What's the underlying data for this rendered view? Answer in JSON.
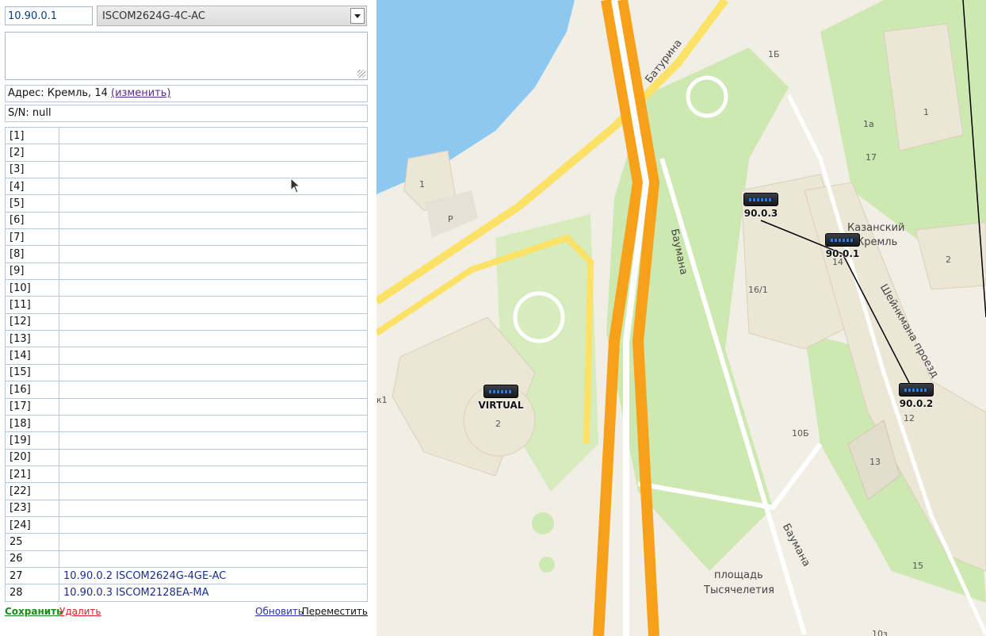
{
  "device": {
    "ip": "10.90.0.1",
    "model": "ISCOM2624G-4C-AC",
    "comment": "",
    "address_label": "Адрес: Кремль, 14",
    "address_change": "(изменить)",
    "serial": "S/N: null"
  },
  "ports": [
    {
      "num": "[1]",
      "value": ""
    },
    {
      "num": "[2]",
      "value": ""
    },
    {
      "num": "[3]",
      "value": ""
    },
    {
      "num": "[4]",
      "value": ""
    },
    {
      "num": "[5]",
      "value": ""
    },
    {
      "num": "[6]",
      "value": ""
    },
    {
      "num": "[7]",
      "value": ""
    },
    {
      "num": "[8]",
      "value": ""
    },
    {
      "num": "[9]",
      "value": ""
    },
    {
      "num": "[10]",
      "value": ""
    },
    {
      "num": "[11]",
      "value": ""
    },
    {
      "num": "[12]",
      "value": ""
    },
    {
      "num": "[13]",
      "value": ""
    },
    {
      "num": "[14]",
      "value": ""
    },
    {
      "num": "[15]",
      "value": ""
    },
    {
      "num": "[16]",
      "value": ""
    },
    {
      "num": "[17]",
      "value": ""
    },
    {
      "num": "[18]",
      "value": ""
    },
    {
      "num": "[19]",
      "value": ""
    },
    {
      "num": "[20]",
      "value": ""
    },
    {
      "num": "[21]",
      "value": ""
    },
    {
      "num": "[22]",
      "value": ""
    },
    {
      "num": "[23]",
      "value": ""
    },
    {
      "num": "[24]",
      "value": ""
    },
    {
      "num": "25",
      "value": ""
    },
    {
      "num": "26",
      "value": ""
    },
    {
      "num": "27",
      "value": "10.90.0.2 ISCOM2624G-4GE-AC"
    },
    {
      "num": "28",
      "value": "10.90.0.3 ISCOM2128EA-MA"
    }
  ],
  "actions": {
    "save": "Сохранить",
    "delete": "Удалить",
    "refresh": "Обновить",
    "move": "Переместить"
  },
  "map": {
    "devices": [
      {
        "label": "90.0.3",
        "icon": "switch-icon"
      },
      {
        "label": "90.0.1",
        "icon": "switch-icon"
      },
      {
        "label": "90.0.2",
        "icon": "switch-icon"
      },
      {
        "label": "VIRTUAL",
        "icon": "switch-icon"
      }
    ],
    "streets": [
      "Батурина",
      "Баумана",
      "Баумана",
      "Шейнкмана проезд"
    ],
    "places": [
      "Казанский",
      "Кремль",
      "площадь",
      "Тысячелетия"
    ],
    "house_numbers": [
      "1Б",
      "1",
      "1а",
      "17",
      "1",
      "Р",
      "2",
      "16/1",
      "14",
      "2",
      "12",
      "13",
      "10Б",
      "15",
      "к1",
      "10з"
    ],
    "colors": {
      "water": "#8cc8ef",
      "park": "#cde8b0",
      "road_main": "#f7a11a",
      "road_secondary": "#fbe267",
      "building": "#ece6d6"
    }
  }
}
